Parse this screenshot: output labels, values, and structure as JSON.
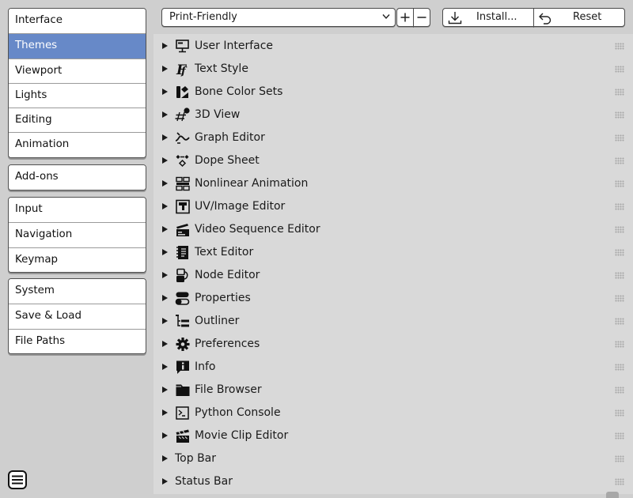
{
  "sidebar": {
    "groups": [
      {
        "items": [
          {
            "label": "Interface",
            "active": false
          },
          {
            "label": "Themes",
            "active": true
          },
          {
            "label": "Viewport",
            "active": false
          },
          {
            "label": "Lights",
            "active": false
          },
          {
            "label": "Editing",
            "active": false
          },
          {
            "label": "Animation",
            "active": false
          }
        ]
      },
      {
        "items": [
          {
            "label": "Add-ons",
            "active": false
          }
        ]
      },
      {
        "items": [
          {
            "label": "Input",
            "active": false
          },
          {
            "label": "Navigation",
            "active": false
          },
          {
            "label": "Keymap",
            "active": false
          }
        ]
      },
      {
        "items": [
          {
            "label": "System",
            "active": false
          },
          {
            "label": "Save & Load",
            "active": false
          },
          {
            "label": "File Paths",
            "active": false
          }
        ]
      }
    ],
    "menu_icon": "hamburger-menu-icon"
  },
  "header": {
    "preset": {
      "value": "Print-Friendly",
      "icon": "chevron-down-icon"
    },
    "add_icon": "plus-icon",
    "remove_icon": "minus-icon",
    "install": {
      "label": "Install...",
      "icon": "import-icon"
    },
    "reset": {
      "label": "Reset",
      "icon": "undo-icon"
    }
  },
  "panels": [
    {
      "label": "User Interface",
      "icon": "user-interface-icon"
    },
    {
      "label": "Text Style",
      "icon": "text-style-icon"
    },
    {
      "label": "Bone Color Sets",
      "icon": "bone-color-sets-icon"
    },
    {
      "label": "3D View",
      "icon": "3d-view-icon"
    },
    {
      "label": "Graph Editor",
      "icon": "graph-editor-icon"
    },
    {
      "label": "Dope Sheet",
      "icon": "dope-sheet-icon"
    },
    {
      "label": "Nonlinear Animation",
      "icon": "nonlinear-animation-icon"
    },
    {
      "label": "UV/Image Editor",
      "icon": "uv-image-editor-icon"
    },
    {
      "label": "Video Sequence Editor",
      "icon": "video-sequence-editor-icon"
    },
    {
      "label": "Text Editor",
      "icon": "text-editor-icon"
    },
    {
      "label": "Node Editor",
      "icon": "node-editor-icon"
    },
    {
      "label": "Properties",
      "icon": "properties-icon"
    },
    {
      "label": "Outliner",
      "icon": "outliner-icon"
    },
    {
      "label": "Preferences",
      "icon": "preferences-gear-icon"
    },
    {
      "label": "Info",
      "icon": "info-icon"
    },
    {
      "label": "File Browser",
      "icon": "file-browser-icon"
    },
    {
      "label": "Python Console",
      "icon": "python-console-icon"
    },
    {
      "label": "Movie Clip Editor",
      "icon": "movie-clip-editor-icon"
    },
    {
      "label": "Top Bar",
      "icon": ""
    },
    {
      "label": "Status Bar",
      "icon": ""
    }
  ],
  "colors": {
    "active_item": "#6789c8",
    "background": "#cfcfcf",
    "panel_background": "#d9d9d9"
  }
}
